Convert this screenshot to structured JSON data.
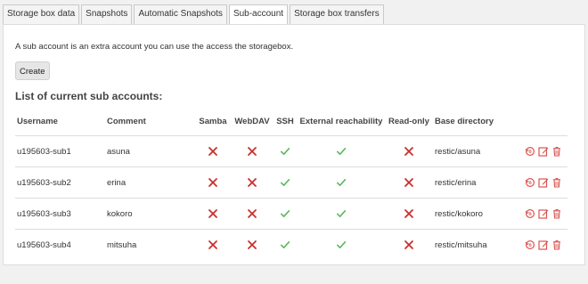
{
  "tabs": [
    {
      "label": "Storage box data"
    },
    {
      "label": "Snapshots"
    },
    {
      "label": "Automatic Snapshots"
    },
    {
      "label": "Sub-account",
      "active": true
    },
    {
      "label": "Storage box transfers"
    }
  ],
  "intro": "A sub account is an extra account you can use the access the storagebox.",
  "create_label": "Create",
  "list_title": "List of current sub accounts:",
  "columns": {
    "username": "Username",
    "comment": "Comment",
    "samba": "Samba",
    "webdav": "WebDAV",
    "ssh": "SSH",
    "external": "External reachability",
    "readonly": "Read-only",
    "base": "Base directory"
  },
  "rows": [
    {
      "username": "u195603-sub1",
      "comment": "asuna",
      "samba": false,
      "webdav": false,
      "ssh": true,
      "external": true,
      "readonly": false,
      "base": "restic/asuna"
    },
    {
      "username": "u195603-sub2",
      "comment": "erina",
      "samba": false,
      "webdav": false,
      "ssh": true,
      "external": true,
      "readonly": false,
      "base": "restic/erina"
    },
    {
      "username": "u195603-sub3",
      "comment": "kokoro",
      "samba": false,
      "webdav": false,
      "ssh": true,
      "external": true,
      "readonly": false,
      "base": "restic/kokoro"
    },
    {
      "username": "u195603-sub4",
      "comment": "mitsuha",
      "samba": false,
      "webdav": false,
      "ssh": true,
      "external": true,
      "readonly": false,
      "base": "restic/mitsuha"
    }
  ],
  "colors": {
    "yes": "#5cb85c",
    "no": "#c9302c",
    "action": "#d9534f"
  },
  "icons": {
    "yes": "check-icon",
    "no": "cross-icon",
    "actions": [
      "reset-password-icon",
      "edit-icon",
      "delete-icon"
    ]
  }
}
